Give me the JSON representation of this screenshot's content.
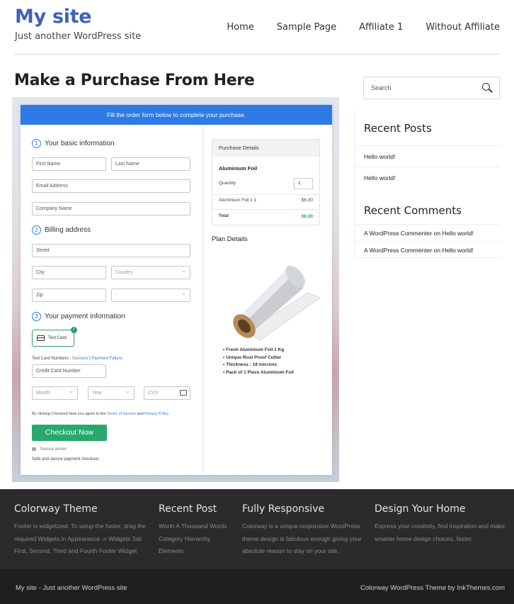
{
  "site": {
    "title": "My site",
    "tagline": "Just another WordPress site"
  },
  "nav": [
    "Home",
    "Sample Page",
    "Affiliate 1",
    "Without Affiliate"
  ],
  "page_title": "Make a Purchase From Here",
  "checkout": {
    "banner": "Fill the order form below to complete your purchase.",
    "section1": {
      "num": "1",
      "label": "Your basic information"
    },
    "first_name": "First Name",
    "last_name": "Last Name",
    "email": "Email Address",
    "company": "Company Name",
    "section2": {
      "num": "2",
      "label": "Billing address"
    },
    "street": "Street",
    "city": "City",
    "country": "Country",
    "zip": "Zip",
    "state": "-",
    "section3": {
      "num": "3",
      "label": "Your payment information"
    },
    "test_card": "Test Card",
    "test_numbers_prefix": "Test Card Numbers :",
    "success": "Success",
    "separator": "|",
    "failure": "Payment Failure",
    "card_number": "Credit Card Number",
    "month": "Month",
    "year": "Year",
    "cvv": "CVV",
    "terms_prefix": "By clicking Checkout Now you agree to the",
    "terms_link": "Terms of Service",
    "terms_and": "and",
    "privacy_link": "Privacy Policy",
    "button": "Checkout Now",
    "secure": "Secure server",
    "safe": "Safe and secure payment checkout."
  },
  "purchase": {
    "heading": "Purchase Details",
    "product": "Aluminium Foil",
    "quantity_label": "Quantity",
    "quantity": "1",
    "line_item": "Aluminium Foil x 1",
    "line_price": "$6.30",
    "total_label": "Total",
    "total": "$6.30"
  },
  "plan": {
    "title": "Plan Details",
    "features": [
      "Fresh Aluminium Foil 1 Kg",
      "Unique Rust Proof Cutter",
      "Thickness : 18 microns",
      "Pack of 1 Piece Aluminium Foil"
    ]
  },
  "sidebar": {
    "search_placeholder": "Search",
    "recent_posts_title": "Recent Posts",
    "recent_posts": [
      "Hello world!",
      "Hello world!"
    ],
    "recent_comments_title": "Recent Comments",
    "comments": [
      {
        "author": "A WordPress Commenter",
        "on": "on",
        "post": "Hello world!"
      },
      {
        "author": "A WordPress Commenter",
        "on": "on",
        "post": "Hello world!"
      }
    ]
  },
  "footer": {
    "col1": {
      "title": "Colorway Theme",
      "text": "Footer is widgetized. To setup the footer, drag the required Widgets in Appearance -> Widgets Tab First, Second, Third and Fourth Footer Widget"
    },
    "col2": {
      "title": "Recent Post",
      "text": "Worth A Thousand Words Category Hierarchy Elements"
    },
    "col3": {
      "title": "Fully Responsive",
      "text": "Colorway is a unique responsive WordPress theme design is fabulous enough giving your absolute reason to stay on your site."
    },
    "col4": {
      "title": "Design Your Home",
      "text": "Express your creativity, find inspiration and make smarter home design choices, faster."
    },
    "bottom_left": "My site - Just another WordPress site",
    "bottom_right": "Colorway WordPress Theme by InkThemes.com"
  },
  "colors": {
    "brand": "#3f63b4",
    "banner": "#2f7ae5",
    "checkout_button": "#28a86b",
    "footer_bg": "#2b2b2b"
  }
}
